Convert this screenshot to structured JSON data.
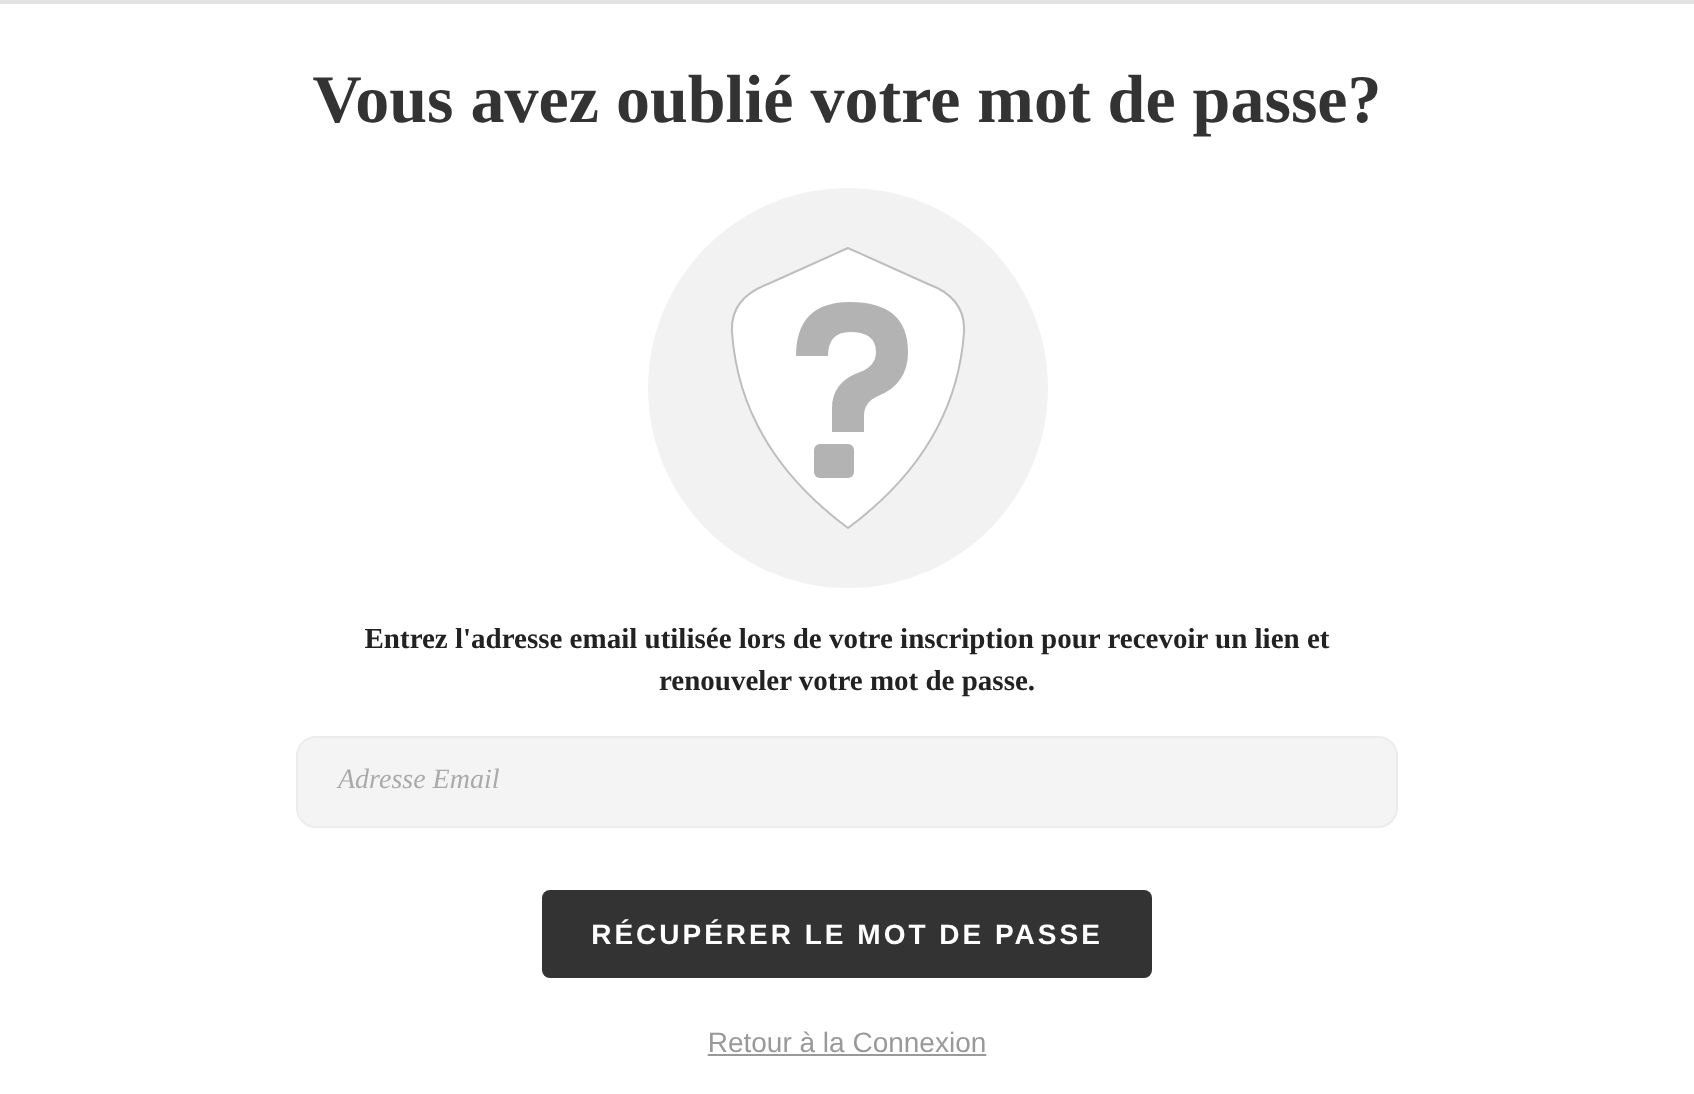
{
  "title": "Vous avez oublié votre mot de passe?",
  "instructions": "Entrez l'adresse email utilisée lors de votre inscription pour recevoir un lien et renouveler votre mot de passe.",
  "email_field": {
    "placeholder": "Adresse Email"
  },
  "submit_button": "RÉCUPÉRER LE MOT DE PASSE",
  "back_link": "Retour à la Connexion"
}
